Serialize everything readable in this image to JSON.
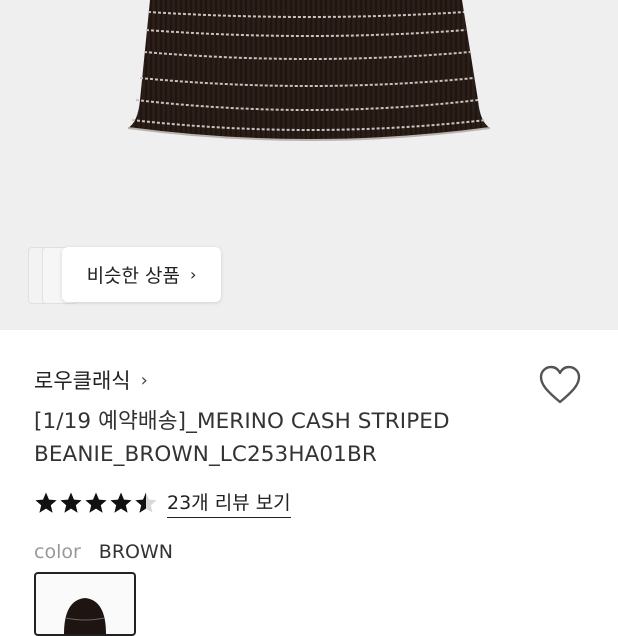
{
  "hero": {
    "similar_label": "비슷한 상품",
    "chevron": "›"
  },
  "brand": {
    "name": "로우클래식",
    "chevron": "›"
  },
  "product": {
    "title_line1": "[1/19 예약배송]_MERINO CASH STRIPED",
    "title_line2": "BEANIE_BROWN_LC253HA01BR",
    "rating": 4.5,
    "stars_total": 5,
    "review_link": "23개 리뷰 보기"
  },
  "option": {
    "label": "color",
    "value": "BROWN"
  },
  "icons": {
    "heart": "heart-icon",
    "star_full": "star-icon",
    "star_half": "half-star-icon"
  },
  "colors": {
    "accent": "#222222",
    "muted": "#999999",
    "hero_bg": "#efefef",
    "beanie": "#2a1d18"
  }
}
